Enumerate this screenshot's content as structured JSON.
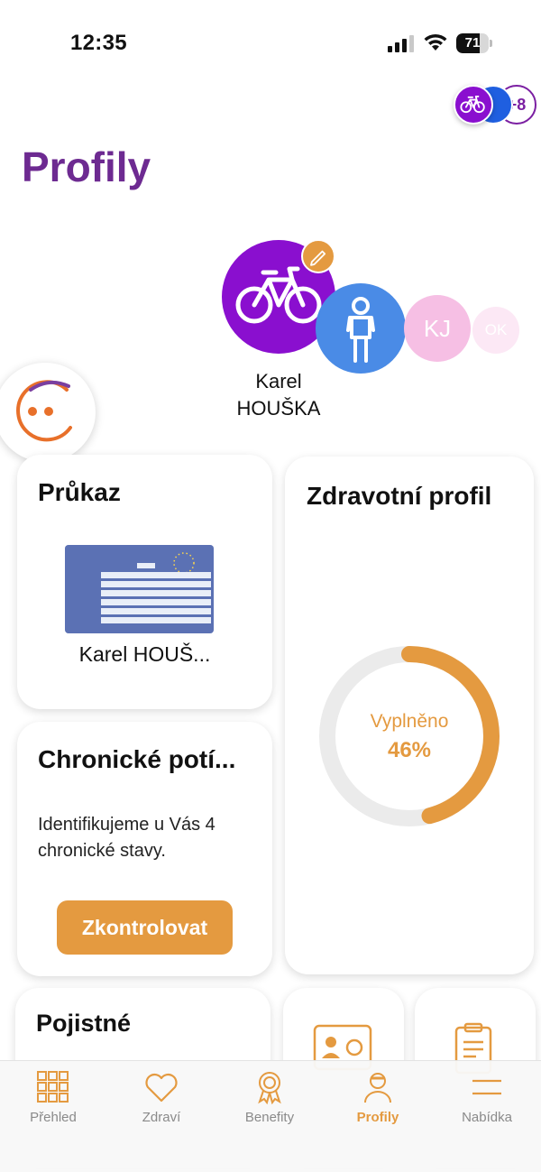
{
  "status_bar": {
    "time": "12:35",
    "battery": "71",
    "battery_level": 0.71
  },
  "header": {
    "more_profiles": "+8",
    "title": "Profily"
  },
  "profiles": {
    "selected_name_line1": "Karel",
    "selected_name_line2": "HOUŠKA",
    "others": [
      "KJ",
      "OK"
    ]
  },
  "card_prukaz": {
    "title": "Průkaz",
    "owner": "Karel HOUŠ..."
  },
  "card_zdravotni": {
    "title": "Zdravotní profil",
    "filled_label": "Vyplněno",
    "filled_value": "46%",
    "filled_fraction": 0.46
  },
  "card_chronicke": {
    "title": "Chronické potí...",
    "text": "Identifikujeme u Vás 4 chronické stavy.",
    "button": "Zkontrolovat"
  },
  "card_pojistne": {
    "title": "Pojistné"
  },
  "tabbar": {
    "items": [
      {
        "label": "Přehled",
        "icon": "grid-icon"
      },
      {
        "label": "Zdraví",
        "icon": "heart-icon"
      },
      {
        "label": "Benefity",
        "icon": "award-icon"
      },
      {
        "label": "Profily",
        "icon": "person-icon"
      },
      {
        "label": "Nabídka",
        "icon": "menu-icon"
      }
    ],
    "active": "Profily"
  },
  "colors": {
    "accent": "#e49a40",
    "title": "#6d2a91",
    "profile_purple": "#8a0fcf",
    "profile_blue": "#4a8be6"
  }
}
